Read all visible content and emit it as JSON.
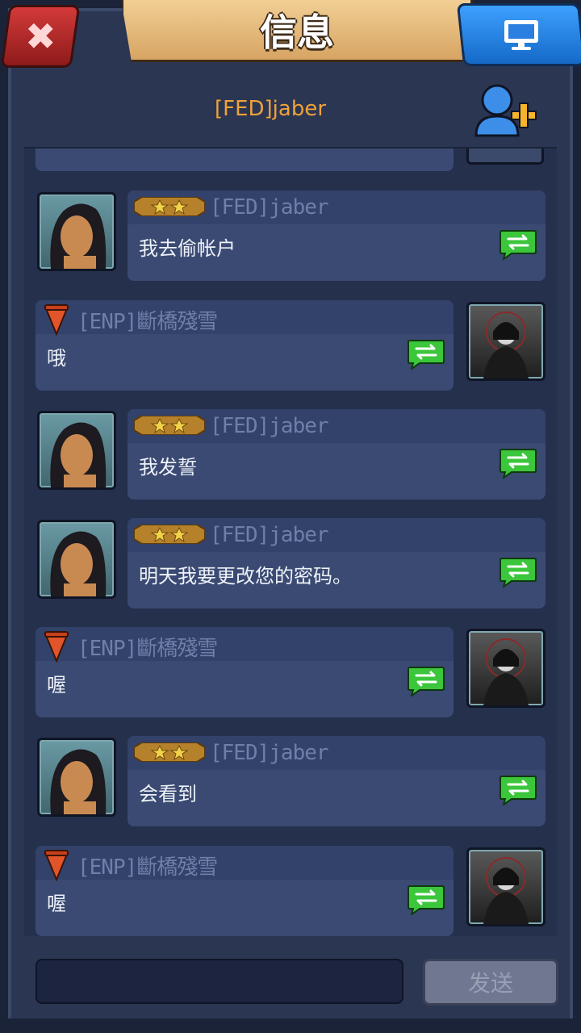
{
  "window": {
    "title": "信息",
    "close_icon": "close-icon",
    "screen_icon": "monitor-icon"
  },
  "header": {
    "chat_partner": "[FED]jaber",
    "add_friend_icon": "add-friend-icon"
  },
  "messages": [
    {
      "side": "right",
      "sender": "[FED]jaber",
      "text": "我去偷帐户",
      "badge": "rank-stars"
    },
    {
      "side": "left",
      "sender": "[ENP]斷橋殘雪",
      "text": "哦",
      "badge": "rank-flag"
    },
    {
      "side": "right",
      "sender": "[FED]jaber",
      "text": "我发誓",
      "badge": "rank-stars"
    },
    {
      "side": "right",
      "sender": "[FED]jaber",
      "text": "明天我要更改您的密码。",
      "badge": "rank-stars"
    },
    {
      "side": "left",
      "sender": "[ENP]斷橋殘雪",
      "text": "喔",
      "badge": "rank-flag"
    },
    {
      "side": "right",
      "sender": "[FED]jaber",
      "text": "会看到",
      "badge": "rank-stars"
    },
    {
      "side": "left",
      "sender": "[ENP]斷橋殘雪",
      "text": "喔",
      "badge": "rank-flag"
    }
  ],
  "composer": {
    "input_value": "",
    "send_label": "发送"
  },
  "colors": {
    "accent_name": "#f0a13a",
    "bubble": "#3a4a72",
    "share_green": "#3bc63b"
  }
}
